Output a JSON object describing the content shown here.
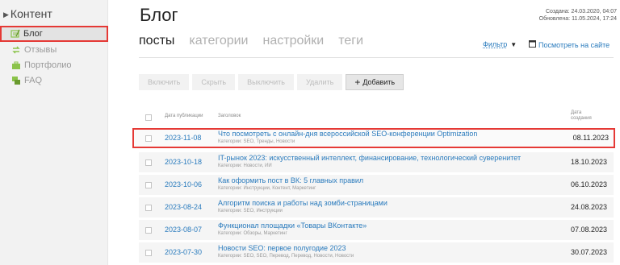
{
  "sidebar": {
    "title": "Контент",
    "items": [
      {
        "label": "Блог",
        "icon": "blog-icon"
      },
      {
        "label": "Отзывы",
        "icon": "reviews-icon"
      },
      {
        "label": "Портфолио",
        "icon": "portfolio-icon"
      },
      {
        "label": "FAQ",
        "icon": "faq-icon"
      }
    ]
  },
  "header": {
    "title": "Блог",
    "created": "Создана: 24.03.2020, 04:07",
    "updated": "Обновлена: 11.05.2024, 17:24"
  },
  "tabs": [
    "посты",
    "категории",
    "настройки",
    "теги"
  ],
  "filter_label": "Фильтр",
  "view_site_label": "Посмотреть на сайте",
  "toolbar": {
    "enable": "Включить",
    "hide": "Скрыть",
    "disable": "Выключить",
    "delete": "Удалить",
    "add": "Добавить"
  },
  "table": {
    "headers": {
      "date": "Дата публикации",
      "title": "Заголовок",
      "published": "Дата создания"
    },
    "rows": [
      {
        "date": "2023-11-08",
        "title": "Что посмотреть с онлайн-дня всероссийской SEO-конференции Optimization",
        "cats": "Категории: SEO, Тренды, Новости",
        "created": "08.11.2023"
      },
      {
        "date": "2023-10-18",
        "title": "IT-рынок 2023: искусственный интеллект, финансирование, технологический суверенитет",
        "cats": "Категории: Новости, ИИ",
        "created": "18.10.2023"
      },
      {
        "date": "2023-10-06",
        "title": "Как оформить пост в ВК: 5 главных правил",
        "cats": "Категории: Инструкции, Контент, Маркетинг",
        "created": "06.10.2023"
      },
      {
        "date": "2023-08-24",
        "title": "Алгоритм поиска и работы над зомби-страницами",
        "cats": "Категории: SEO, Инструкции",
        "created": "24.08.2023"
      },
      {
        "date": "2023-08-07",
        "title": "Функционал площадки «Товары ВКонтакте»",
        "cats": "Категории: Обзоры, Маркетинг",
        "created": "07.08.2023"
      },
      {
        "date": "2023-07-30",
        "title": "Новости SEO: первое полугодие 2023",
        "cats": "Категории: SEO, SEO, Перевод, Перевод, Новости, Новости",
        "created": "30.07.2023"
      }
    ]
  },
  "colors": {
    "accent": "#2a7bbd",
    "highlight": "#e53935",
    "sidebar_bg": "#f2f2f2",
    "icon_green": "#8bc34a"
  }
}
